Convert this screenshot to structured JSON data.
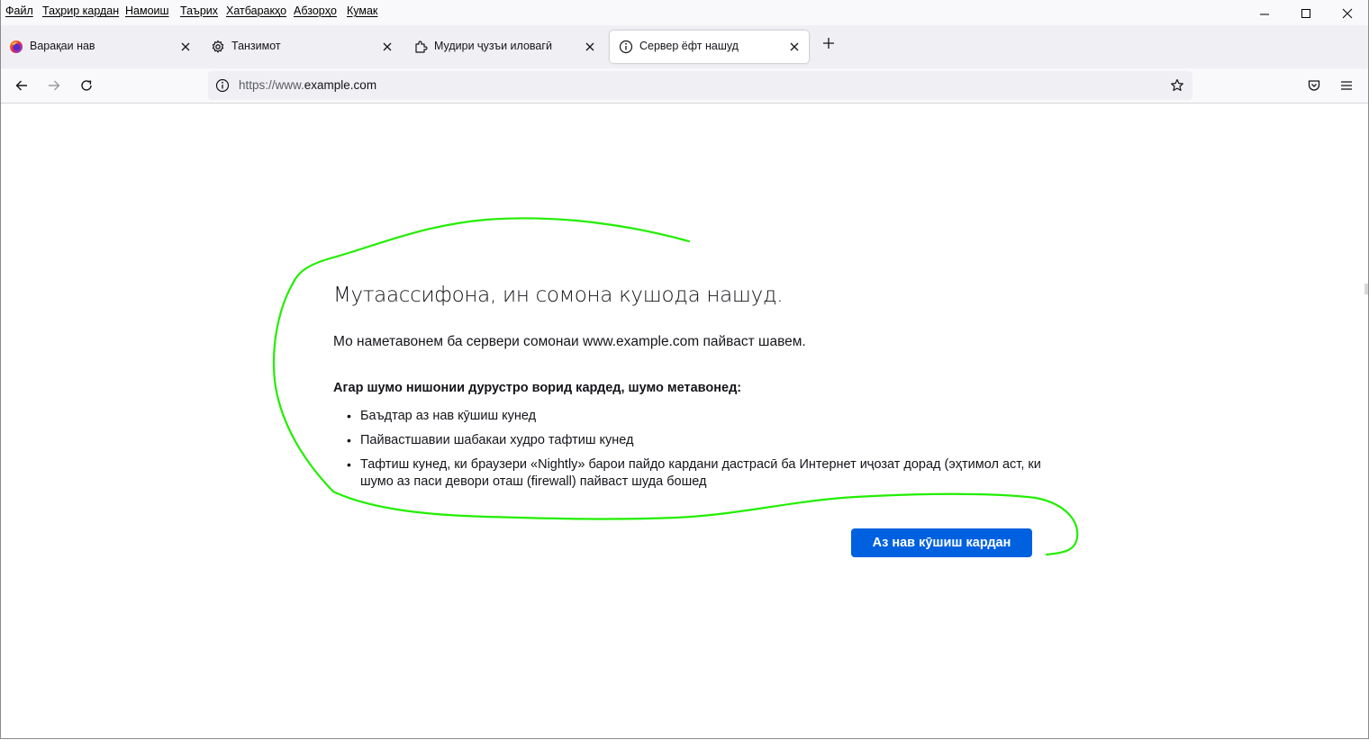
{
  "menubar": {
    "items": [
      "Файл",
      "Таҳрир кардан",
      "Намоиш",
      "Таърих",
      "Хатбаракҳо",
      "Абзорҳо",
      "Кумак"
    ]
  },
  "tabs": [
    {
      "title": "Варақаи нав",
      "icon": "firefox-icon"
    },
    {
      "title": "Танзимот",
      "icon": "gear-icon"
    },
    {
      "title": "Мудири ҷузъи иловагӣ",
      "icon": "puzzle-icon"
    },
    {
      "title": "Сервер ёфт нашуд",
      "icon": "info-icon",
      "active": true
    }
  ],
  "urlbar": {
    "scheme": "https://www.",
    "host": "example.com"
  },
  "error": {
    "title": "Мутаассифона, ин сомона кушода нашуд.",
    "description": "Мо наметавонем ба сервери сомонаи www.example.com пайваст шавем.",
    "heading": "Агар шумо нишонии дурустро ворид кардед, шумо метавонед:",
    "suggestions": [
      "Баъдтар аз нав кӯшиш кунед",
      "Пайвастшавии шабакаи худро тафтиш кунед",
      "Тафтиш кунед, ки браузери «Nightly» барои пайдо кардани дастрасӣ ба Интернет иҷозат дорад (эҳтимол аст, ки шумо аз паси девори оташ (firewall) пайваст шуда бошед"
    ],
    "retry_label": "Аз нав кӯшиш кардан"
  },
  "colors": {
    "accent": "#0061e0",
    "annotation": "#22ee00"
  }
}
